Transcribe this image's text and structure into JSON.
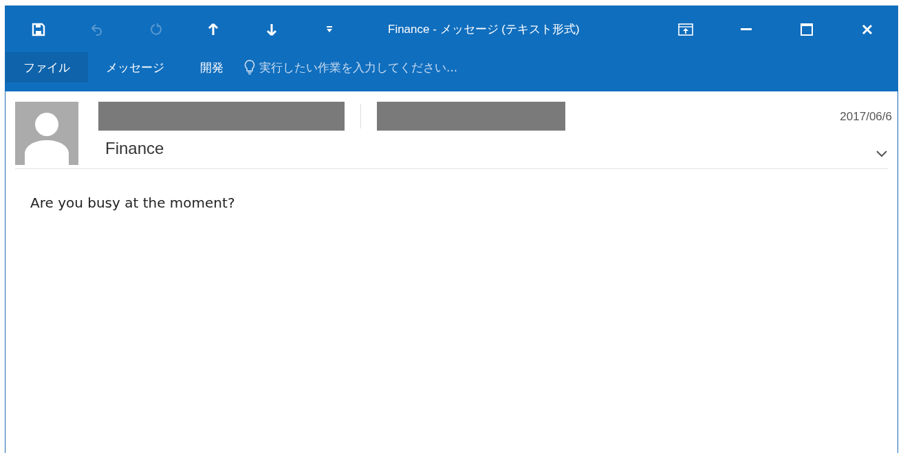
{
  "window": {
    "title": "Finance - メッセージ (テキスト形式)"
  },
  "quick_access": [
    {
      "kind": "save",
      "disabled": false
    },
    {
      "kind": "undo",
      "disabled": true
    },
    {
      "kind": "redo",
      "disabled": true
    },
    {
      "kind": "up",
      "disabled": false
    },
    {
      "kind": "down",
      "disabled": false
    },
    {
      "kind": "customize",
      "disabled": false
    }
  ],
  "ribbon_tabs": [
    {
      "label": "ファイル",
      "selected": true
    },
    {
      "label": "メッセージ",
      "selected": false
    },
    {
      "label": "開発",
      "selected": false
    }
  ],
  "tell_me": {
    "placeholder": "実行したい作業を入力してください..."
  },
  "message": {
    "sender_name": "Finance",
    "date": "2017/06/6",
    "body": "Are you busy at the moment?"
  }
}
